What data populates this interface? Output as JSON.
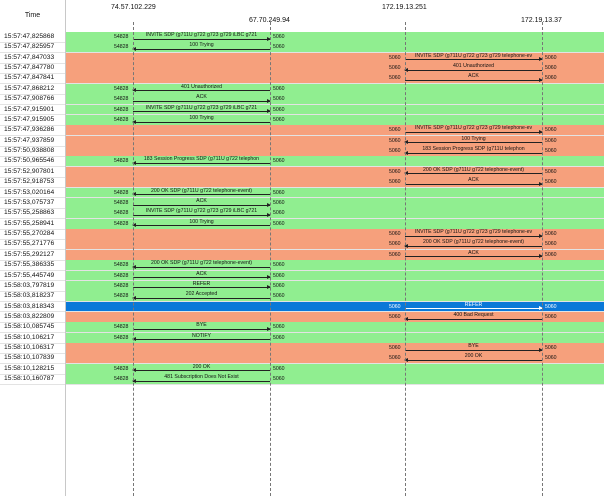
{
  "header": {
    "time_label": "Time"
  },
  "hosts": [
    "74.57.102.229",
    "67.70.249.94",
    "172.19.13.251",
    "172.19.13.37"
  ],
  "colors": {
    "green": "#90ee90",
    "salmon": "#f6a07c",
    "selected": "#0a78d8"
  },
  "rows": [
    {
      "time": "15:57:47,825868",
      "bg": "green",
      "dir": "right",
      "pair": "ab",
      "left_port": "54828",
      "right_port": "5060",
      "label": "INVITE SDP (g711U g722 g723 g729 iLBC g721"
    },
    {
      "time": "15:57:47,825957",
      "bg": "green",
      "dir": "left",
      "pair": "ab",
      "left_port": "54828",
      "right_port": "5060",
      "label": "100 Trying"
    },
    {
      "time": "15:57:47,847033",
      "bg": "salmon",
      "dir": "right",
      "pair": "cd",
      "left_port": "5060",
      "right_port": "5060",
      "label": "INVITE SDP (g711U g722 g723 g729 telephone-ev"
    },
    {
      "time": "15:57:47,847780",
      "bg": "salmon",
      "dir": "left",
      "pair": "cd",
      "left_port": "5060",
      "right_port": "5060",
      "label": "401 Unauthorized"
    },
    {
      "time": "15:57:47,847841",
      "bg": "salmon",
      "dir": "right",
      "pair": "cd",
      "left_port": "5060",
      "right_port": "5060",
      "label": "ACK"
    },
    {
      "time": "15:57:47,868212",
      "bg": "green",
      "dir": "left",
      "pair": "ab",
      "left_port": "54828",
      "right_port": "5060",
      "label": "401 Unauthorized"
    },
    {
      "time": "15:57:47,908766",
      "bg": "green",
      "dir": "right",
      "pair": "ab",
      "left_port": "54828",
      "right_port": "5060",
      "label": "ACK"
    },
    {
      "time": "15:57:47,915901",
      "bg": "green",
      "dir": "right",
      "pair": "ab",
      "left_port": "54828",
      "right_port": "5060",
      "label": "INVITE SDP (g711U g722 g723 g729 iLBC g721"
    },
    {
      "time": "15:57:47,915905",
      "bg": "green",
      "dir": "left",
      "pair": "ab",
      "left_port": "54828",
      "right_port": "5060",
      "label": "100 Trying"
    },
    {
      "time": "15:57:47,936286",
      "bg": "salmon",
      "dir": "right",
      "pair": "cd",
      "left_port": "5060",
      "right_port": "5060",
      "label": "INVITE SDP (g711U g722 g723 g729 telephone-ev"
    },
    {
      "time": "15:57:47,937859",
      "bg": "salmon",
      "dir": "left",
      "pair": "cd",
      "left_port": "5060",
      "right_port": "5060",
      "label": "100 Trying"
    },
    {
      "time": "15:57:50,938808",
      "bg": "salmon",
      "dir": "left",
      "pair": "cd",
      "left_port": "5060",
      "right_port": "5060",
      "label": "183 Session Progress SDP (g711U telephon"
    },
    {
      "time": "15:57:50,965546",
      "bg": "green",
      "dir": "left",
      "pair": "ab",
      "left_port": "54828",
      "right_port": "5060",
      "label": "183 Session Progress SDP (g711U g722 telephon"
    },
    {
      "time": "15:57:52,907801",
      "bg": "salmon",
      "dir": "left",
      "pair": "cd",
      "left_port": "5060",
      "right_port": "5060",
      "label": "200 OK SDP (g711U g722 telephone-event)"
    },
    {
      "time": "15:57:52,918753",
      "bg": "salmon",
      "dir": "right",
      "pair": "cd",
      "left_port": "5060",
      "right_port": "5060",
      "label": "ACK"
    },
    {
      "time": "15:57:53,020164",
      "bg": "green",
      "dir": "left",
      "pair": "ab",
      "left_port": "54828",
      "right_port": "5060",
      "label": "200 OK SDP (g711U g722 telephone-event)"
    },
    {
      "time": "15:57:53,075737",
      "bg": "green",
      "dir": "right",
      "pair": "ab",
      "left_port": "54828",
      "right_port": "5060",
      "label": "ACK"
    },
    {
      "time": "15:57:55,258863",
      "bg": "green",
      "dir": "right",
      "pair": "ab",
      "left_port": "54828",
      "right_port": "5060",
      "label": "INVITE SDP (g711U g722 g723 g729 iLBC g721"
    },
    {
      "time": "15:57:55,258941",
      "bg": "green",
      "dir": "left",
      "pair": "ab",
      "left_port": "54828",
      "right_port": "5060",
      "label": "100 Trying"
    },
    {
      "time": "15:57:55,270284",
      "bg": "salmon",
      "dir": "right",
      "pair": "cd",
      "left_port": "5060",
      "right_port": "5060",
      "label": "INVITE SDP (g711U g722 g723 g729 telephone-ev"
    },
    {
      "time": "15:57:55,271776",
      "bg": "salmon",
      "dir": "left",
      "pair": "cd",
      "left_port": "5060",
      "right_port": "5060",
      "label": "200 OK SDP (g711U g722 telephone-event)"
    },
    {
      "time": "15:57:55,292127",
      "bg": "salmon",
      "dir": "right",
      "pair": "cd",
      "left_port": "5060",
      "right_port": "5060",
      "label": "ACK"
    },
    {
      "time": "15:57:55,386335",
      "bg": "green",
      "dir": "left",
      "pair": "ab",
      "left_port": "54828",
      "right_port": "5060",
      "label": "200 OK SDP (g711U g722 telephone-event)"
    },
    {
      "time": "15:57:55,445749",
      "bg": "green",
      "dir": "right",
      "pair": "ab",
      "left_port": "54828",
      "right_port": "5060",
      "label": "ACK"
    },
    {
      "time": "15:58:03,797819",
      "bg": "green",
      "dir": "right",
      "pair": "ab",
      "left_port": "54828",
      "right_port": "5060",
      "label": "REFER"
    },
    {
      "time": "15:58:03,818237",
      "bg": "green",
      "dir": "left",
      "pair": "ab",
      "left_port": "54828",
      "right_port": "5060",
      "label": "202 Accepted"
    },
    {
      "time": "15:58:03,818343",
      "bg": "selected",
      "dir": "right",
      "pair": "cd",
      "left_port": "5060",
      "right_port": "5060",
      "label": "REFER"
    },
    {
      "time": "15:58:03,822809",
      "bg": "salmon",
      "dir": "left",
      "pair": "cd",
      "left_port": "5060",
      "right_port": "5060",
      "label": "400 Bad Request"
    },
    {
      "time": "15:58:10,085745",
      "bg": "green",
      "dir": "right",
      "pair": "ab",
      "left_port": "54828",
      "right_port": "5060",
      "label": "BYE"
    },
    {
      "time": "15:58:10,106217",
      "bg": "green",
      "dir": "left",
      "pair": "ab",
      "left_port": "54828",
      "right_port": "5060",
      "label": "NOTIFY"
    },
    {
      "time": "15:58:10,106317",
      "bg": "salmon",
      "dir": "right",
      "pair": "cd",
      "left_port": "5060",
      "right_port": "5060",
      "label": "BYE"
    },
    {
      "time": "15:58:10,107839",
      "bg": "salmon",
      "dir": "left",
      "pair": "cd",
      "left_port": "5060",
      "right_port": "5060",
      "label": "200 OK"
    },
    {
      "time": "15:58:10,128215",
      "bg": "green",
      "dir": "left",
      "pair": "ab",
      "left_port": "54828",
      "right_port": "5060",
      "label": "200 OK"
    },
    {
      "time": "15:58:10,160787",
      "bg": "green",
      "dir": "left",
      "pair": "ab",
      "left_port": "54828",
      "right_port": "5060",
      "label": "481 Subscription Does Not Exist"
    }
  ]
}
